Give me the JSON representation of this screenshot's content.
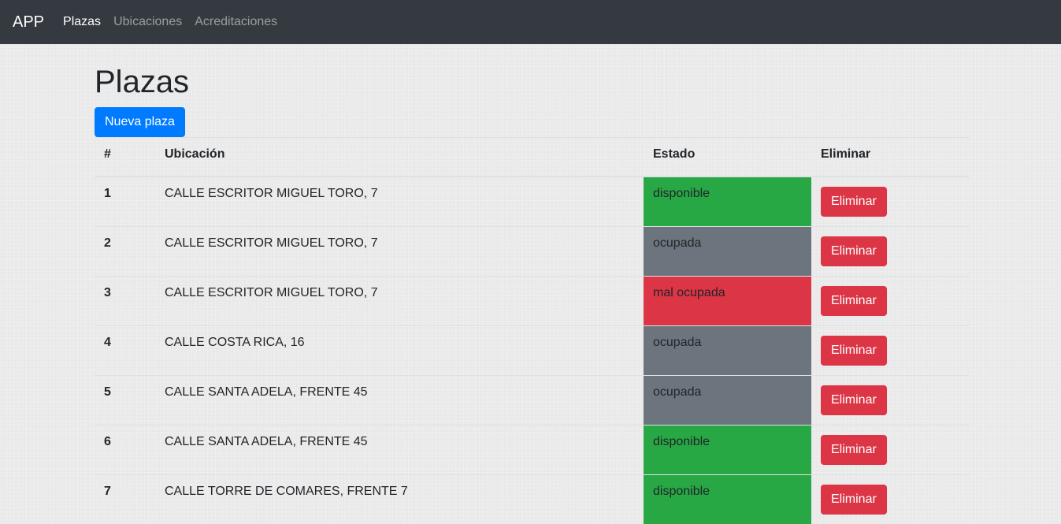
{
  "navbar": {
    "brand": "APP",
    "links": [
      {
        "label": "Plazas",
        "active": true
      },
      {
        "label": "Ubicaciones",
        "active": false
      },
      {
        "label": "Acreditaciones",
        "active": false
      }
    ]
  },
  "page": {
    "title": "Plazas",
    "new_button": "Nueva plaza"
  },
  "table": {
    "headers": [
      "#",
      "Ubicación",
      "Estado",
      "Eliminar"
    ],
    "rows": [
      {
        "id": "1",
        "location": "CALLE ESCRITOR MIGUEL TORO, 7",
        "state": "disponible",
        "state_color": "#28a745",
        "action": "Eliminar"
      },
      {
        "id": "2",
        "location": "CALLE ESCRITOR MIGUEL TORO, 7",
        "state": "ocupada",
        "state_color": "#6c757d",
        "action": "Eliminar"
      },
      {
        "id": "3",
        "location": "CALLE ESCRITOR MIGUEL TORO, 7",
        "state": "mal ocupada",
        "state_color": "#dc3545",
        "action": "Eliminar"
      },
      {
        "id": "4",
        "location": "CALLE COSTA RICA, 16",
        "state": "ocupada",
        "state_color": "#6c757d",
        "action": "Eliminar"
      },
      {
        "id": "5",
        "location": "CALLE SANTA ADELA, FRENTE 45",
        "state": "ocupada",
        "state_color": "#6c757d",
        "action": "Eliminar"
      },
      {
        "id": "6",
        "location": "CALLE SANTA ADELA, FRENTE 45",
        "state": "disponible",
        "state_color": "#28a745",
        "action": "Eliminar"
      },
      {
        "id": "7",
        "location": "CALLE TORRE DE COMARES, FRENTE 7",
        "state": "disponible",
        "state_color": "#28a745",
        "action": "Eliminar"
      }
    ]
  },
  "colors": {
    "navbar_bg": "#343a40",
    "primary": "#007bff",
    "danger": "#dc3545",
    "success": "#28a745",
    "secondary": "#6c757d"
  }
}
